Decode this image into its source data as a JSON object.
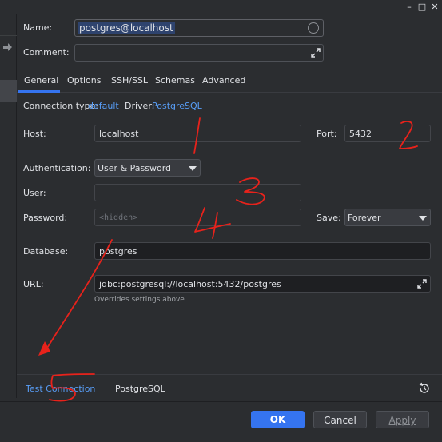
{
  "window": {
    "minimize_glyph": "–",
    "maximize_glyph": "□",
    "close_glyph": "✕"
  },
  "name": {
    "label": "Name:",
    "value": "postgres@localhost"
  },
  "comment": {
    "label": "Comment:",
    "value": ""
  },
  "tabs": [
    {
      "label": "General",
      "active": true
    },
    {
      "label": "Options",
      "active": false
    },
    {
      "label": "SSH/SSL",
      "active": false
    },
    {
      "label": "Schemas",
      "active": false
    },
    {
      "label": "Advanced",
      "active": false
    }
  ],
  "connection_info": {
    "type_label": "Connection type:",
    "type_value": "default",
    "driver_label": "Driver:",
    "driver_value": "PostgreSQL"
  },
  "host": {
    "label": "Host:",
    "value": "localhost"
  },
  "port": {
    "label": "Port:",
    "value": "5432"
  },
  "authentication": {
    "label": "Authentication:",
    "value": "User & Password"
  },
  "user": {
    "label": "User:",
    "value": ""
  },
  "password": {
    "label": "Password:",
    "placeholder": "<hidden>"
  },
  "save": {
    "label": "Save:",
    "value": "Forever"
  },
  "database": {
    "label": "Database:",
    "value": "postgres"
  },
  "url": {
    "label": "URL:",
    "value": "jdbc:postgresql://localhost:5432/postgres",
    "hint": "Overrides settings above"
  },
  "bottom": {
    "test_connection": "Test Connection",
    "driver": "PostgreSQL"
  },
  "footer": {
    "ok": "OK",
    "cancel": "Cancel",
    "apply": "Apply"
  },
  "annotations": [
    "1",
    "2",
    "3",
    "4",
    "5"
  ],
  "colors": {
    "accent": "#3574f0",
    "link": "#589df6",
    "annotation": "#e8221b"
  }
}
